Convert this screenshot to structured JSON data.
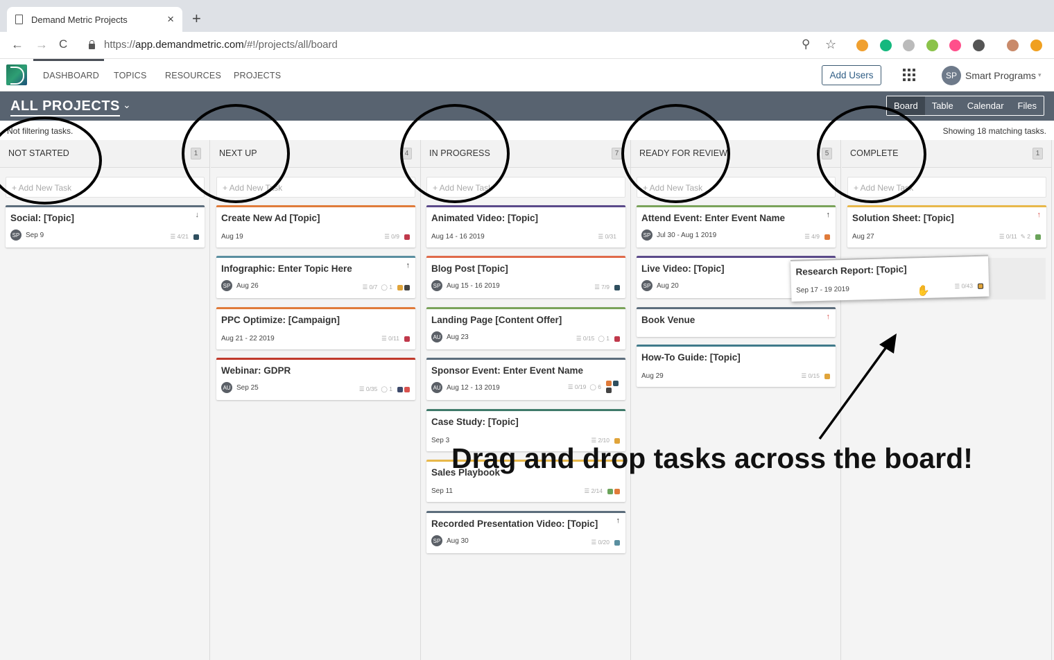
{
  "browser": {
    "tab_title": "Demand Metric Projects",
    "tab_close": "×",
    "new_tab": "+",
    "url_scheme": "https://",
    "url_host": "app.demandmetric.com",
    "url_path": "/#!/projects/all/board",
    "back": "←",
    "forward": "→",
    "reload": "C",
    "zoom_icon": "⚲",
    "star_icon": "☆"
  },
  "nav": {
    "items": [
      "DASHBOARD",
      "TOPICS",
      "RESOURCES",
      "PROJECTS"
    ],
    "add_users": "Add Users",
    "avatar": "SP",
    "user_name": "Smart Programs",
    "user_caret": "▾"
  },
  "project": {
    "title": "ALL PROJECTS",
    "caret": "⌄",
    "views": [
      "Board",
      "Table",
      "Calendar",
      "Files"
    ],
    "active_view": "Board"
  },
  "filter_info": "Not filtering tasks.",
  "match_info": "Showing 18 matching tasks.",
  "add_task_placeholder": "+ Add New Task",
  "columns": [
    {
      "title": "NOT STARTED",
      "count": "1",
      "cards": [
        {
          "title": "Social: [Topic]",
          "date": "Sep 9",
          "avatar": "SP",
          "subtasks": "☰ 4/21",
          "color": "#5c6d7c",
          "squares": [
            "#2f4f5f"
          ],
          "priority": "↓",
          "priority_color": "#666"
        }
      ]
    },
    {
      "title": "NEXT UP",
      "count": "4",
      "cards": [
        {
          "title": "Create New Ad [Topic]",
          "date": "Aug 19",
          "avatar": "",
          "subtasks": "☰ 0/9",
          "color": "#e07b3a",
          "squares": [
            "#c0394b"
          ]
        },
        {
          "title": "Infographic: Enter Topic Here",
          "date": "Aug 26",
          "avatar": "SP",
          "subtasks": "☰ 0/7",
          "comments": "◯ 1",
          "color": "#5a8fa0",
          "squares": [
            "#e0a43a",
            "#444"
          ],
          "priority": "↑",
          "priority_color": "#333"
        },
        {
          "title": "PPC Optimize: [Campaign]",
          "date": "Aug 21 - 22 2019",
          "avatar": "",
          "subtasks": "☰ 0/11",
          "color": "#e07b3a",
          "squares": [
            "#c0394b"
          ]
        },
        {
          "title": "Webinar: GDPR",
          "date": "Sep 25",
          "avatar": "AU",
          "subtasks": "☰ 0/35",
          "comments": "◯ 1",
          "color": "#c0392b",
          "squares": [
            "#3d4a6b",
            "#d9534f"
          ]
        }
      ]
    },
    {
      "title": "IN PROGRESS",
      "count": "7",
      "cards": [
        {
          "title": "Animated Video: [Topic]",
          "date": "Aug 14 - 16 2019",
          "avatar": "",
          "subtasks": "☰ 0/31",
          "color": "#5b4a8a",
          "squares": []
        },
        {
          "title": "Blog Post [Topic]",
          "date": "Aug 15 - 16 2019",
          "avatar": "SP",
          "subtasks": "☰ 7/9",
          "color": "#e06a4a",
          "squares": [
            "#2f4f5f"
          ]
        },
        {
          "title": "Landing Page [Content Offer]",
          "date": "Aug 23",
          "avatar": "AU",
          "subtasks": "☰ 0/15",
          "comments": "◯ 1",
          "color": "#7aa35a",
          "squares": [
            "#c0394b"
          ]
        },
        {
          "title": "Sponsor Event: Enter Event Name",
          "date": "Aug 12 - 13 2019",
          "avatar": "AU",
          "subtasks": "☰ 0/19",
          "comments": "◯ 6",
          "color": "#5c6d7c",
          "squares": [
            "#e07b3a",
            "#2f4f5f",
            "#444"
          ]
        },
        {
          "title": "Case Study: [Topic]",
          "date": "Sep 3",
          "avatar": "",
          "subtasks": "☰ 2/10",
          "color": "#3f7a6a",
          "squares": [
            "#e0a43a"
          ]
        },
        {
          "title": "Sales Playbook",
          "date": "Sep 11",
          "avatar": "",
          "subtasks": "☰ 2/14",
          "color": "#e8b84a",
          "squares": [
            "#6aa35a",
            "#e07b3a"
          ]
        },
        {
          "title": "Recorded Presentation Video: [Topic]",
          "date": "Aug 30",
          "avatar": "SP",
          "subtasks": "☰ 0/20",
          "color": "#5c6d7c",
          "squares": [
            "#5a8fa0"
          ],
          "priority": "↑",
          "priority_color": "#333"
        }
      ]
    },
    {
      "title": "READY FOR REVIEW",
      "count": "5",
      "cards": [
        {
          "title": "Attend Event: Enter Event Name",
          "date": "Jul 30 - Aug 1 2019",
          "avatar": "SP",
          "subtasks": "☰ 4/9",
          "color": "#7aa35a",
          "squares": [
            "#e07b3a"
          ],
          "priority": "↑",
          "priority_color": "#333"
        },
        {
          "title": "Live Video: [Topic]",
          "date": "Aug 20",
          "avatar": "SP",
          "subtasks": "",
          "color": "#5b4a8a",
          "squares": []
        },
        {
          "title": "Book Venue",
          "date": "",
          "avatar": "",
          "subtasks": "",
          "color": "#5c6d7c",
          "squares": [],
          "priority": "↑",
          "priority_color": "#d9534f"
        },
        {
          "title": "How-To Guide: [Topic]",
          "date": "Aug 29",
          "avatar": "",
          "subtasks": "☰ 0/15",
          "color": "#3f7a8a",
          "squares": [
            "#e0a43a"
          ]
        }
      ]
    },
    {
      "title": "COMPLETE",
      "count": "1",
      "cards": [
        {
          "title": "Solution Sheet: [Topic]",
          "date": "Aug 27",
          "avatar": "",
          "subtasks": "☰ 0/11",
          "comments": "✎ 2",
          "color": "#e8b84a",
          "squares": [
            "#6aa35a"
          ],
          "priority": "↑",
          "priority_color": "#d9534f"
        }
      ]
    }
  ],
  "dragged_card": {
    "title": "Research Report: [Topic]",
    "date": "Sep 17 - 19 2019",
    "subtasks": "☰ 0/43",
    "squares": [
      "#e0a43a"
    ],
    "hand": "✋"
  },
  "annotation": "Drag and drop tasks across the board!",
  "extensions": [
    {
      "name": "rss-extension-icon",
      "color": "#f0a030"
    },
    {
      "name": "grammarly-extension-icon",
      "color": "#15b87e"
    },
    {
      "name": "toggle-extension-icon",
      "color": "#bbbbbb"
    },
    {
      "name": "android-extension-icon",
      "color": "#8bc34a"
    },
    {
      "name": "pink-dot-extension-icon",
      "color": "#ff4f8b"
    },
    {
      "name": "directions-extension-icon",
      "color": "#555555"
    },
    {
      "name": "profile-extension-icon",
      "color": "#c98a6a"
    },
    {
      "name": "orange-extension-icon",
      "color": "#f0a020"
    }
  ]
}
